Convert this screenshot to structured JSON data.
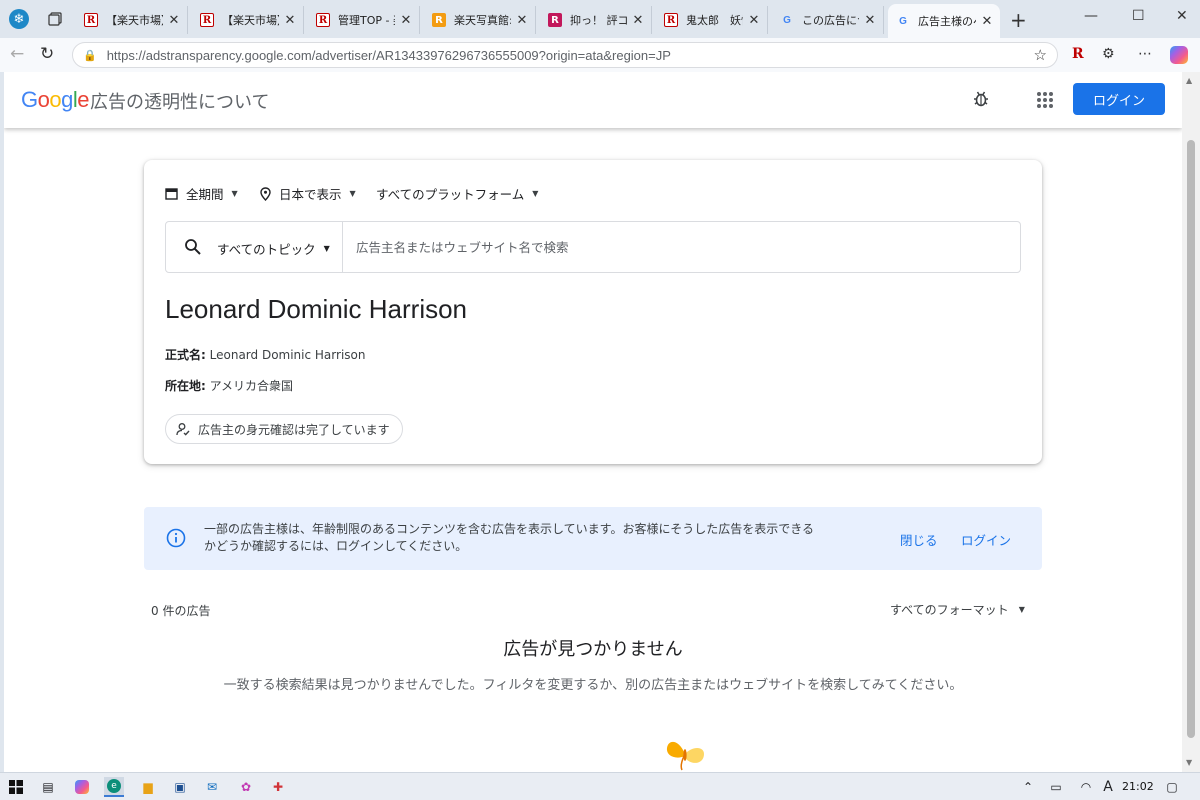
{
  "browser": {
    "tabs": [
      {
        "title": "【楽天市場】Sh",
        "favicon": "rakuten-r"
      },
      {
        "title": "【楽天市場】パ",
        "favicon": "rakuten-r"
      },
      {
        "title": "管理TOP - 楽",
        "favicon": "rakuten-r"
      },
      {
        "title": "楽天写真館: T",
        "favicon": "rakuten-orange"
      },
      {
        "title": "抑っ！ 評コレ",
        "favicon": "rakuten-pink"
      },
      {
        "title": "鬼太郎　妖怪",
        "favicon": "rakuten-r"
      },
      {
        "title": "この広告につい",
        "favicon": "google-g"
      },
      {
        "title": "広告主様のペ",
        "favicon": "google-g",
        "active": true
      }
    ],
    "url": "https://adstransparency.google.com/advertiser/AR13433976296736555009?origin=ata&region=JP"
  },
  "header": {
    "logo_text": "Google",
    "site_title": "広告の透明性について",
    "login_label": "ログイン"
  },
  "filters": {
    "period": "全期間",
    "region": "日本で表示",
    "platform": "すべてのプラットフォーム"
  },
  "search": {
    "topic": "すべてのトピック",
    "placeholder": "広告主名またはウェブサイト名で検索"
  },
  "advertiser": {
    "name": "Leonard Dominic Harrison",
    "legal_name_label": "正式名:",
    "legal_name": "Leonard Dominic Harrison",
    "location_label": "所在地:",
    "location": "アメリカ合衆国",
    "verified_label": "広告主の身元確認は完了しています"
  },
  "banner": {
    "text": "一部の広告主様は、年齢制限のあるコンテンツを含む広告を表示しています。お客様にそうした広告を表示できるかどうか確認するには、ログインしてください。",
    "close_label": "閉じる",
    "login_label": "ログイン"
  },
  "results": {
    "count_text": "0 件の広告",
    "format_filter": "すべてのフォーマット",
    "empty_title": "広告が見つかりません",
    "empty_desc": "一致する検索結果は見つかりませんでした。フィルタを変更するか、別の広告主またはウェブサイトを検索してみてください。"
  },
  "taskbar": {
    "time": "21:02",
    "ime": "A"
  },
  "colors": {
    "primary": "#1a73e8",
    "banner_bg": "#e8f0fe"
  }
}
